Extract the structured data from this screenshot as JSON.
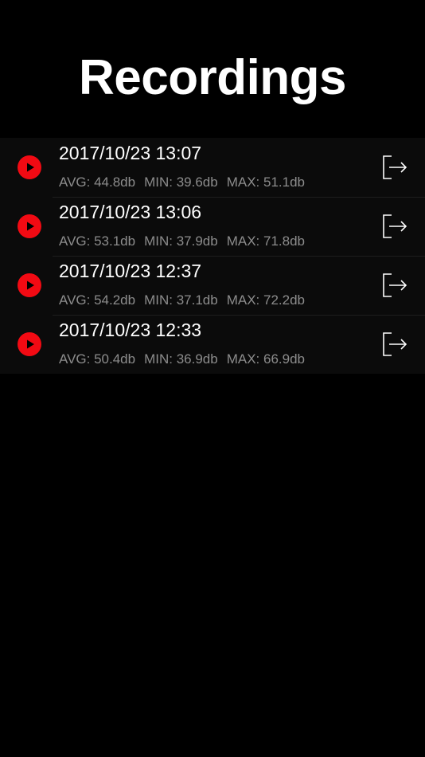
{
  "header": {
    "title": "Recordings"
  },
  "colors": {
    "background": "#000000",
    "row_background": "#0b0b0b",
    "accent": "#f20a13",
    "primary_text": "#ffffff",
    "secondary_text": "#8c8c8c"
  },
  "recordings": [
    {
      "date": "2017/10/23 13:07",
      "avg": "AVG: 44.8db",
      "min": "MIN: 39.6db",
      "max": "MAX: 51.1db",
      "play_icon": "play-icon",
      "export_icon": "export-icon"
    },
    {
      "date": "2017/10/23 13:06",
      "avg": "AVG: 53.1db",
      "min": "MIN: 37.9db",
      "max": "MAX: 71.8db",
      "play_icon": "play-icon",
      "export_icon": "export-icon"
    },
    {
      "date": "2017/10/23 12:37",
      "avg": "AVG: 54.2db",
      "min": "MIN: 37.1db",
      "max": "MAX: 72.2db",
      "play_icon": "play-icon",
      "export_icon": "export-icon"
    },
    {
      "date": "2017/10/23 12:33",
      "avg": "AVG: 50.4db",
      "min": "MIN: 36.9db",
      "max": "MAX: 66.9db",
      "play_icon": "play-icon",
      "export_icon": "export-icon"
    }
  ]
}
